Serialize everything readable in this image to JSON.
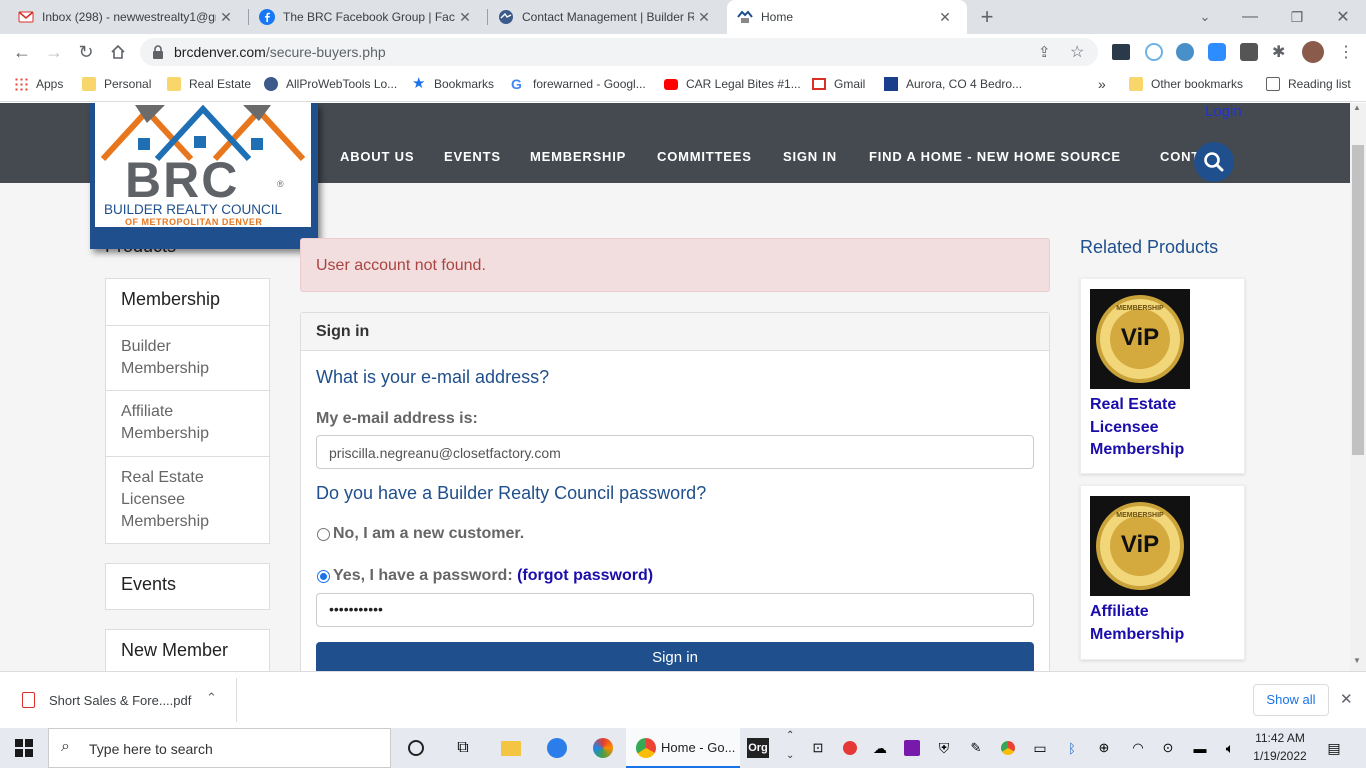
{
  "tabs": [
    {
      "title": "Inbox (298) - newwestrealty1@gr",
      "icon": "gmail-icon"
    },
    {
      "title": "The BRC Facebook Group | Faceb",
      "icon": "facebook-icon"
    },
    {
      "title": "Contact Management | Builder Re",
      "icon": "globe-icon"
    },
    {
      "title": "Home",
      "icon": "brc-favicon",
      "active": true
    }
  ],
  "address_bar": {
    "domain": "brcdenver.com",
    "path": "/secure-buyers.php"
  },
  "bookmarks": {
    "apps": "Apps",
    "items": [
      "Personal",
      "Real Estate",
      "AllProWebTools Lo...",
      "Bookmarks",
      "forewarned - Googl...",
      "CAR Legal Bites #1...",
      "Gmail",
      "Aurora, CO 4 Bedro..."
    ],
    "overflow": "»",
    "other": "Other bookmarks",
    "reading_list": "Reading list"
  },
  "site": {
    "logo": {
      "wordmark": "BRC",
      "line1": "BUILDER REALTY COUNCIL",
      "line2": "OF METROPOLITAN DENVER",
      "registered": "®"
    },
    "login": "Login",
    "nav": [
      "ABOUT US",
      "EVENTS",
      "MEMBERSHIP",
      "COMMITTEES",
      "SIGN IN",
      "FIND A HOME - NEW HOME SOURCE",
      "CONTACT"
    ]
  },
  "sidebar": {
    "heading": "Products",
    "membership_title": "Membership",
    "membership_items": [
      "Builder Membership",
      "Affiliate Membership",
      "Real Estate Licensee Membership"
    ],
    "events": "Events",
    "new_member": "New Member"
  },
  "alert": "User account not found.",
  "signin": {
    "title": "Sign in",
    "q_email": "What is your e-mail address?",
    "email_label": "My e-mail address is:",
    "email_value": "priscilla.negreanu@closetfactory.com",
    "q_password": "Do you have a Builder Realty Council password?",
    "opt_new": "No, I am a new customer.",
    "opt_existing": "Yes, I have a password:",
    "forgot": "(forgot password)",
    "password_mask": "•••••••••••",
    "button": "Sign in",
    "selected_option": "existing"
  },
  "related": {
    "title": "Related Products",
    "badge_text": "MEMBERSHIP",
    "badge_big": "ViP",
    "products": [
      {
        "name": "Real Estate Licensee Membership"
      },
      {
        "name": "Affiliate Membership"
      }
    ]
  },
  "download": {
    "file": "Short Sales & Fore....pdf",
    "show_all": "Show all"
  },
  "taskbar": {
    "search_placeholder": "Type here to search",
    "chrome_label": "Home - Go...",
    "time": "11:42 AM",
    "date": "1/19/2022"
  },
  "colors": {
    "brand_blue": "#1f4f8c",
    "brand_orange": "#e8761c",
    "header_gray": "#444a50",
    "alert_bg": "#f2dede",
    "alert_text": "#a94442"
  }
}
